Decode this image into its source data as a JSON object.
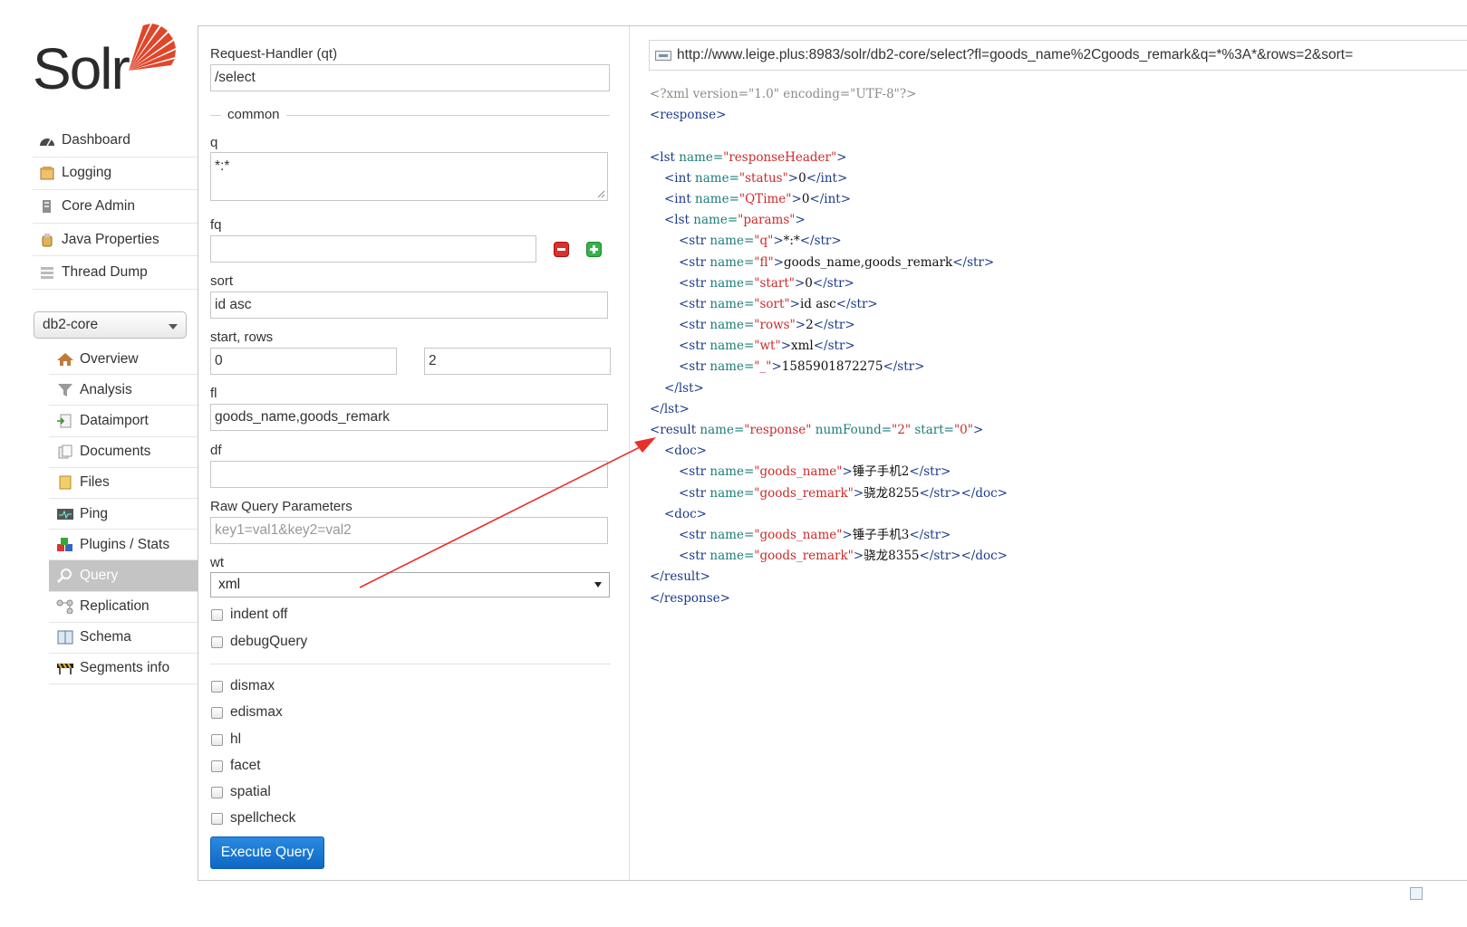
{
  "logo": {
    "text": "Solr",
    "accent": "#e0462a"
  },
  "main_nav": [
    {
      "label": "Dashboard",
      "icon": "dashboard-icon"
    },
    {
      "label": "Logging",
      "icon": "logging-icon"
    },
    {
      "label": "Core Admin",
      "icon": "core-admin-icon"
    },
    {
      "label": "Java Properties",
      "icon": "java-icon"
    },
    {
      "label": "Thread Dump",
      "icon": "thread-dump-icon"
    }
  ],
  "core_selector": {
    "value": "db2-core"
  },
  "core_nav": [
    {
      "label": "Overview",
      "icon": "home-icon"
    },
    {
      "label": "Analysis",
      "icon": "funnel-icon"
    },
    {
      "label": "Dataimport",
      "icon": "import-icon"
    },
    {
      "label": "Documents",
      "icon": "documents-icon"
    },
    {
      "label": "Files",
      "icon": "folder-icon"
    },
    {
      "label": "Ping",
      "icon": "ping-icon"
    },
    {
      "label": "Plugins / Stats",
      "icon": "plugins-icon"
    },
    {
      "label": "Query",
      "icon": "magnifier-icon",
      "active": true
    },
    {
      "label": "Replication",
      "icon": "replication-icon"
    },
    {
      "label": "Schema",
      "icon": "schema-icon"
    },
    {
      "label": "Segments info",
      "icon": "segments-icon"
    }
  ],
  "form": {
    "request_handler_label": "Request-Handler (qt)",
    "request_handler_value": "/select",
    "common_legend": "common",
    "q_label": "q",
    "q_value": "*:*",
    "fq_label": "fq",
    "fq_value": "",
    "sort_label": "sort",
    "sort_value": "id asc",
    "start_rows_label": "start, rows",
    "start_value": "0",
    "rows_value": "2",
    "fl_label": "fl",
    "fl_value": "goods_name,goods_remark",
    "df_label": "df",
    "df_value": "",
    "raw_label": "Raw Query Parameters",
    "raw_placeholder": "key1=val1&key2=val2",
    "wt_label": "wt",
    "wt_value": "xml",
    "checkboxes_top": [
      "indent off",
      "debugQuery"
    ],
    "checkboxes_bottom": [
      "dismax",
      "edismax",
      "hl",
      "facet",
      "spatial",
      "spellcheck"
    ],
    "execute_label": "Execute Query"
  },
  "result": {
    "url": "http://www.leige.plus:8983/solr/db2-core/select?fl=goods_name%2Cgoods_remark&q=*%3A*&rows=2&sort=",
    "xml_lines": [
      {
        "indent": 0,
        "parts": [
          [
            "pi",
            "<?xml version=\"1.0\" encoding=\"UTF-8\"?>"
          ]
        ]
      },
      {
        "indent": 0,
        "parts": [
          [
            "tag",
            "<response>"
          ]
        ]
      },
      {
        "indent": 0,
        "parts": []
      },
      {
        "indent": 0,
        "parts": [
          [
            "tag",
            "<lst "
          ],
          [
            "an",
            "name="
          ],
          [
            "av",
            "\"responseHeader\""
          ],
          [
            "tag",
            ">"
          ]
        ]
      },
      {
        "indent": 1,
        "parts": [
          [
            "tag",
            "<int "
          ],
          [
            "an",
            "name="
          ],
          [
            "av",
            "\"status\""
          ],
          [
            "tag",
            ">"
          ],
          [
            "tx",
            "0"
          ],
          [
            "tag",
            "</int>"
          ]
        ]
      },
      {
        "indent": 1,
        "parts": [
          [
            "tag",
            "<int "
          ],
          [
            "an",
            "name="
          ],
          [
            "av",
            "\"QTime\""
          ],
          [
            "tag",
            ">"
          ],
          [
            "tx",
            "0"
          ],
          [
            "tag",
            "</int>"
          ]
        ]
      },
      {
        "indent": 1,
        "parts": [
          [
            "tag",
            "<lst "
          ],
          [
            "an",
            "name="
          ],
          [
            "av",
            "\"params\""
          ],
          [
            "tag",
            ">"
          ]
        ]
      },
      {
        "indent": 2,
        "parts": [
          [
            "tag",
            "<str "
          ],
          [
            "an",
            "name="
          ],
          [
            "av",
            "\"q\""
          ],
          [
            "tag",
            ">"
          ],
          [
            "tx",
            "*:*"
          ],
          [
            "tag",
            "</str>"
          ]
        ]
      },
      {
        "indent": 2,
        "parts": [
          [
            "tag",
            "<str "
          ],
          [
            "an",
            "name="
          ],
          [
            "av",
            "\"fl\""
          ],
          [
            "tag",
            ">"
          ],
          [
            "tx",
            "goods_name,goods_remark"
          ],
          [
            "tag",
            "</str>"
          ]
        ]
      },
      {
        "indent": 2,
        "parts": [
          [
            "tag",
            "<str "
          ],
          [
            "an",
            "name="
          ],
          [
            "av",
            "\"start\""
          ],
          [
            "tag",
            ">"
          ],
          [
            "tx",
            "0"
          ],
          [
            "tag",
            "</str>"
          ]
        ]
      },
      {
        "indent": 2,
        "parts": [
          [
            "tag",
            "<str "
          ],
          [
            "an",
            "name="
          ],
          [
            "av",
            "\"sort\""
          ],
          [
            "tag",
            ">"
          ],
          [
            "tx",
            "id asc"
          ],
          [
            "tag",
            "</str>"
          ]
        ]
      },
      {
        "indent": 2,
        "parts": [
          [
            "tag",
            "<str "
          ],
          [
            "an",
            "name="
          ],
          [
            "av",
            "\"rows\""
          ],
          [
            "tag",
            ">"
          ],
          [
            "tx",
            "2"
          ],
          [
            "tag",
            "</str>"
          ]
        ]
      },
      {
        "indent": 2,
        "parts": [
          [
            "tag",
            "<str "
          ],
          [
            "an",
            "name="
          ],
          [
            "av",
            "\"wt\""
          ],
          [
            "tag",
            ">"
          ],
          [
            "tx",
            "xml"
          ],
          [
            "tag",
            "</str>"
          ]
        ]
      },
      {
        "indent": 2,
        "parts": [
          [
            "tag",
            "<str "
          ],
          [
            "an",
            "name="
          ],
          [
            "av",
            "\"_\""
          ],
          [
            "tag",
            ">"
          ],
          [
            "tx",
            "1585901872275"
          ],
          [
            "tag",
            "</str>"
          ]
        ]
      },
      {
        "indent": 1,
        "parts": [
          [
            "tag",
            "</lst>"
          ]
        ]
      },
      {
        "indent": 0,
        "parts": [
          [
            "tag",
            "</lst>"
          ]
        ]
      },
      {
        "indent": 0,
        "parts": [
          [
            "tag",
            "<result "
          ],
          [
            "an",
            "name="
          ],
          [
            "av",
            "\"response\" "
          ],
          [
            "an",
            "numFound="
          ],
          [
            "av",
            "\"2\" "
          ],
          [
            "an",
            "start="
          ],
          [
            "av",
            "\"0\""
          ],
          [
            "tag",
            ">"
          ]
        ]
      },
      {
        "indent": 1,
        "parts": [
          [
            "tag",
            "<doc>"
          ]
        ]
      },
      {
        "indent": 2,
        "parts": [
          [
            "tag",
            "<str "
          ],
          [
            "an",
            "name="
          ],
          [
            "av",
            "\"goods_name\""
          ],
          [
            "tag",
            ">"
          ],
          [
            "tx",
            "锤子手机2"
          ],
          [
            "tag",
            "</str>"
          ]
        ]
      },
      {
        "indent": 2,
        "parts": [
          [
            "tag",
            "<str "
          ],
          [
            "an",
            "name="
          ],
          [
            "av",
            "\"goods_remark\""
          ],
          [
            "tag",
            ">"
          ],
          [
            "tx",
            "骁龙8255"
          ],
          [
            "tag",
            "</str></doc>"
          ]
        ]
      },
      {
        "indent": 1,
        "parts": [
          [
            "tag",
            "<doc>"
          ]
        ]
      },
      {
        "indent": 2,
        "parts": [
          [
            "tag",
            "<str "
          ],
          [
            "an",
            "name="
          ],
          [
            "av",
            "\"goods_name\""
          ],
          [
            "tag",
            ">"
          ],
          [
            "tx",
            "锤子手机3"
          ],
          [
            "tag",
            "</str>"
          ]
        ]
      },
      {
        "indent": 2,
        "parts": [
          [
            "tag",
            "<str "
          ],
          [
            "an",
            "name="
          ],
          [
            "av",
            "\"goods_remark\""
          ],
          [
            "tag",
            ">"
          ],
          [
            "tx",
            "骁龙8355"
          ],
          [
            "tag",
            "</str></doc>"
          ]
        ]
      },
      {
        "indent": 0,
        "parts": [
          [
            "tag",
            "</result>"
          ]
        ]
      },
      {
        "indent": 0,
        "parts": [
          [
            "tag",
            "</response>"
          ]
        ]
      }
    ]
  },
  "annotation": {
    "arrow_color": "#e8302a"
  }
}
